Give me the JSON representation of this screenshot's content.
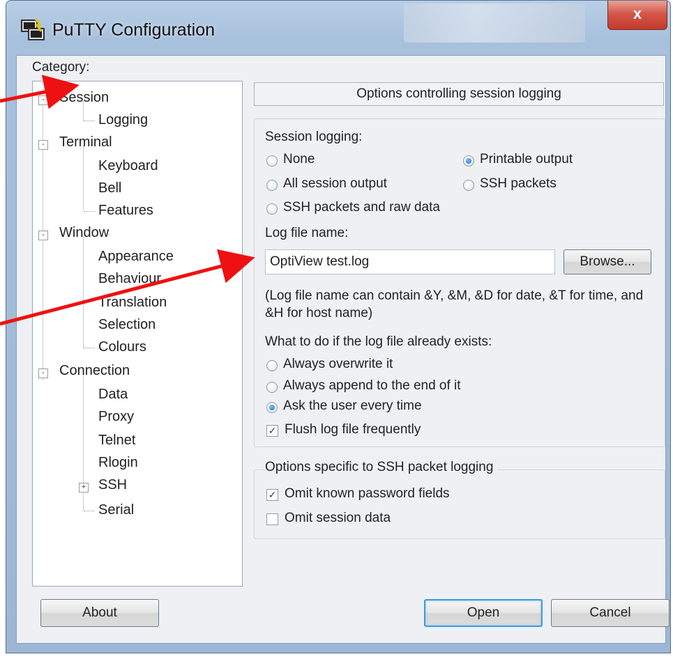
{
  "window": {
    "title": "PuTTY Configuration",
    "close_label": "x"
  },
  "category": {
    "label": "Category:",
    "tree": [
      {
        "label": "Session",
        "level": 0,
        "expander": "-"
      },
      {
        "label": "Logging",
        "level": 1
      },
      {
        "label": "Terminal",
        "level": 0,
        "expander": "-"
      },
      {
        "label": "Keyboard",
        "level": 1
      },
      {
        "label": "Bell",
        "level": 1
      },
      {
        "label": "Features",
        "level": 1
      },
      {
        "label": "Window",
        "level": 0,
        "expander": "-"
      },
      {
        "label": "Appearance",
        "level": 1
      },
      {
        "label": "Behaviour",
        "level": 1
      },
      {
        "label": "Translation",
        "level": 1
      },
      {
        "label": "Selection",
        "level": 1
      },
      {
        "label": "Colours",
        "level": 1
      },
      {
        "label": "Connection",
        "level": 0,
        "expander": "-"
      },
      {
        "label": "Data",
        "level": 1
      },
      {
        "label": "Proxy",
        "level": 1
      },
      {
        "label": "Telnet",
        "level": 1
      },
      {
        "label": "Rlogin",
        "level": 1
      },
      {
        "label": "SSH",
        "level": 1,
        "expander": "+"
      },
      {
        "label": "Serial",
        "level": 1
      }
    ]
  },
  "panel": {
    "header": "Options controlling session logging",
    "session_logging": {
      "label": "Session logging:",
      "options": [
        "None",
        "Printable output",
        "All session output",
        "SSH packets",
        "SSH packets and raw data"
      ],
      "selected": "Printable output"
    },
    "log_file": {
      "label": "Log file name:",
      "value": "OptiView test.log",
      "browse_label": "Browse...",
      "hint": "(Log file name can contain &Y, &M, &D for date, &T for time, and &H for host name)"
    },
    "exists": {
      "label": "What to do if the log file already exists:",
      "options": [
        "Always overwrite it",
        "Always append to the end of it",
        "Ask the user every time"
      ],
      "selected": "Ask the user every time"
    },
    "flush": {
      "label": "Flush log file frequently",
      "checked": true
    },
    "ssh": {
      "label": "Options specific to SSH packet logging",
      "omit_password": {
        "label": "Omit known password fields",
        "checked": true
      },
      "omit_data": {
        "label": "Omit session data",
        "checked": false
      }
    }
  },
  "buttons": {
    "about": "About",
    "open": "Open",
    "cancel": "Cancel"
  },
  "colors": {
    "annotation_arrow": "#ee1111",
    "default_button_border": "#3c9ae0"
  }
}
